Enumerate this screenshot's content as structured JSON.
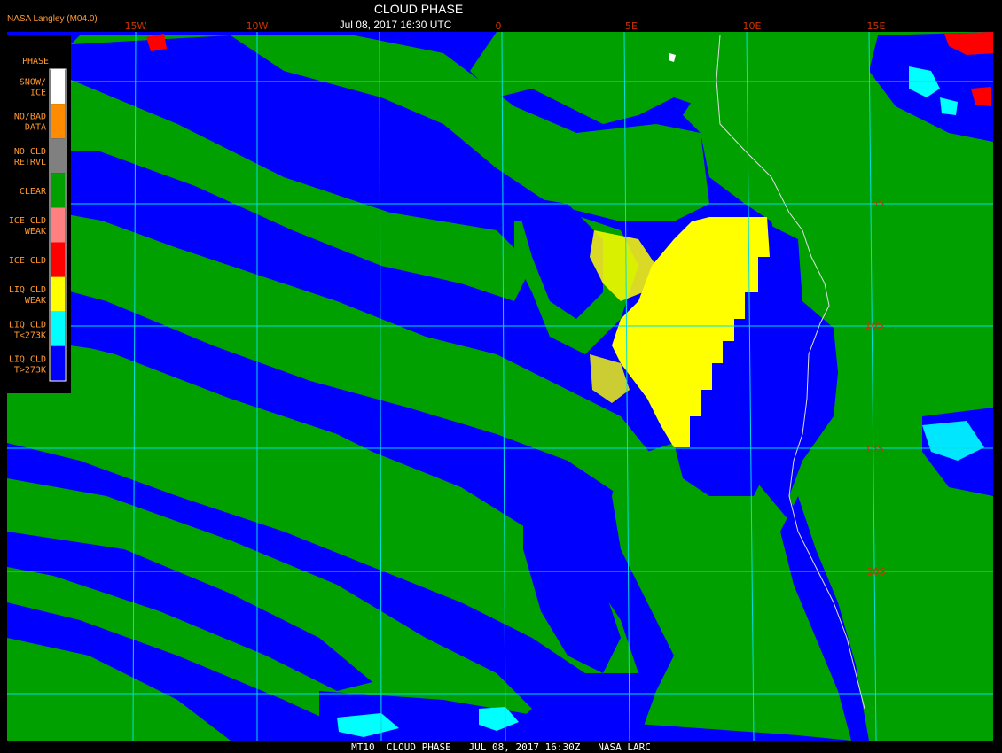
{
  "header": {
    "source": "NASA Langley (M04.0)",
    "title": "CLOUD PHASE",
    "datetime": "Jul 08, 2017 16:30 UTC"
  },
  "footer": {
    "caption": "MT10  CLOUD PHASE   JUL 08, 2017 16:30Z   NASA LARC"
  },
  "legend": {
    "title": "PHASE",
    "items": [
      {
        "lines": [
          "SNOW/",
          "ICE"
        ],
        "color": "#ffffff"
      },
      {
        "lines": [
          "NO/BAD",
          "DATA"
        ],
        "color": "#ff8c00"
      },
      {
        "lines": [
          "NO CLD",
          "RETRVL"
        ],
        "color": "#808080"
      },
      {
        "lines": [
          "CLEAR"
        ],
        "color": "#00a000"
      },
      {
        "lines": [
          "ICE CLD",
          "WEAK"
        ],
        "color": "#ff8080"
      },
      {
        "lines": [
          "ICE CLD"
        ],
        "color": "#ff0000"
      },
      {
        "lines": [
          "LIQ CLD",
          "WEAK"
        ],
        "color": "#ffff00"
      },
      {
        "lines": [
          "LIQ CLD",
          "T<273K"
        ],
        "color": "#00ffff"
      },
      {
        "lines": [
          "LIQ CLD",
          "T>273K"
        ],
        "color": "#0000ff"
      }
    ]
  },
  "longitude_labels": [
    "15W",
    "10W",
    "0",
    "5E",
    "10E",
    "15E"
  ],
  "latitude_labels": [
    "5S",
    "10S",
    "15S",
    "20S"
  ],
  "colors": {
    "background": "#000000",
    "clear": "#00a000",
    "liquid_warm": "#0000ff",
    "liquid_weak": "#ffff00",
    "grid": "#00e0e0",
    "label_text": "#ff8c00",
    "coastline": "#e0e0e0"
  }
}
